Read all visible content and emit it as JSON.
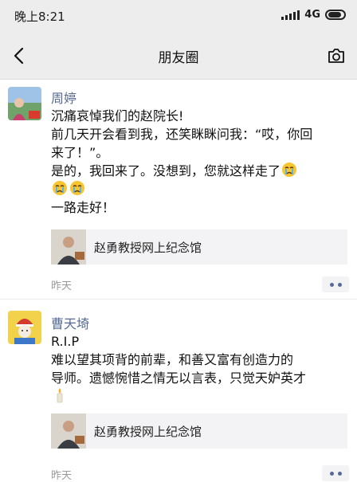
{
  "status_bar": {
    "time": "晚上8:21",
    "network": "4G"
  },
  "nav": {
    "title": "朋友圈",
    "back_icon": "chevron-left-icon",
    "camera_icon": "camera-icon"
  },
  "posts": [
    {
      "author": "周婷",
      "lines": [
        "沉痛哀悼我们的赵院长!",
        "前几天开会看到我，还笑眯眯问我：“哎，你回",
        "来了！”。",
        "是的，我回来了。没想到，您就这样走了",
        "",
        "一路走好！"
      ],
      "emoji": "crying-face-emoji",
      "link_card": {
        "title": "赵勇教授网上纪念馆"
      },
      "time": "昨天"
    },
    {
      "author": "曹天埼",
      "lines": [
        "R.I.P",
        "难以望其项背的前辈，和善又富有创造力的",
        "导师。遗憾惋惜之情无以言表，只觉天妒英才"
      ],
      "emoji": "candle-emoji",
      "link_card": {
        "title": "赵勇教授网上纪念馆"
      },
      "time": "昨天"
    }
  ],
  "colors": {
    "author_name": "#576b95",
    "nav_background": "#ededed",
    "card_background": "#f3f3f5",
    "time_text": "#9a9a9a"
  }
}
